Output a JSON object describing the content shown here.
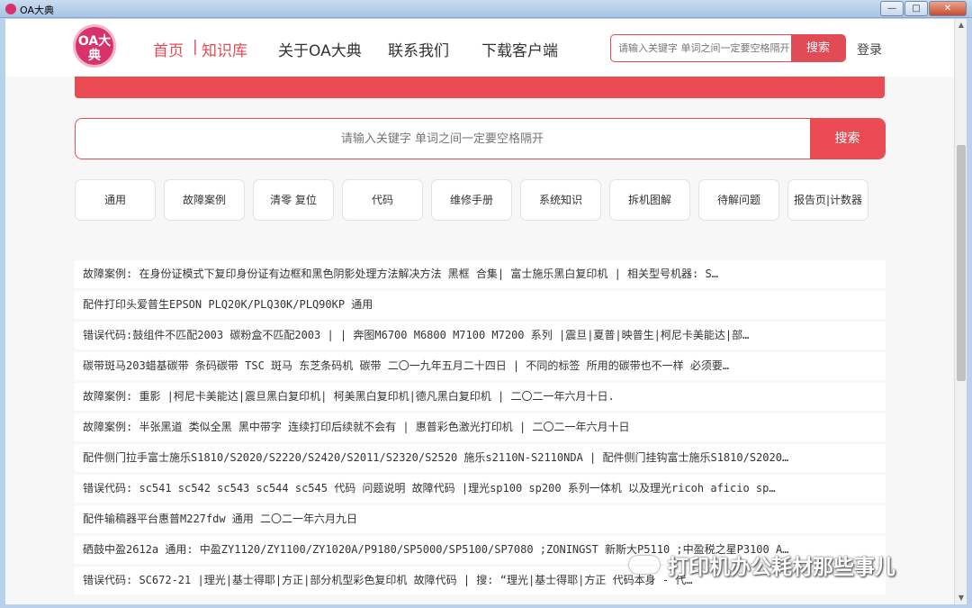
{
  "window": {
    "title": "OA大典",
    "minimize": "—",
    "maximize": "□",
    "close": "✕"
  },
  "nav": {
    "logo_text": "OA大典",
    "home": "首页",
    "sep": "|",
    "knowledge": "知识库",
    "about": "关于OA大典",
    "contact": "联系我们",
    "download": "下载客户端",
    "login": "登录"
  },
  "top_search": {
    "placeholder": "请输入关键字 单词之间一定要空格隔开",
    "button": "搜索"
  },
  "main_search": {
    "placeholder": "请输入关键字 单词之间一定要空格隔开",
    "button": "搜索"
  },
  "categories": [
    "通用",
    "故障案例",
    "清零 复位",
    "代码",
    "维修手册",
    "系统知识",
    "拆机图解",
    "待解问题",
    "报告页|计数器"
  ],
  "results": [
    "故障案例:  在身份证模式下复印身份证有边框和黑色阴影处理方法解决方法 黑框 合集| 富士施乐黑白复印机 | 相关型号机器: S…",
    "配件打印头爱普生EPSON PLQ20K/PLQ30K/PLQ90KP 通用",
    "错误代码:鼓组件不匹配2003 碳粉盒不匹配2003 | | 奔图M6700 M6800 M7100 M7200 系列 |震旦|夏普|映普生|柯尼卡美能达|部…",
    "碳带斑马203蜡基碳带 条码碳带 TSC 斑马 东芝条码机 碳带 二〇一九年五月二十四日 | 不同的标签 所用的碳带也不一样 必须要…",
    "故障案例:  重影 |柯尼卡美能达|震旦黑白复印机| 柯美黑白复印机|德凡黑白复印机 | 二〇二一年六月十日.",
    "故障案例:  半张黑道 类似全黑 黑中带字 连续打印后续就不会有 | 惠普彩色激光打印机 | 二〇二一年六月十日",
    "配件侧门拉手富士施乐S1810/S2020/S2220/S2420/S2011/S2320/S2520 施乐s2110N-S2110NDA | 配件侧门挂钩富士施乐S1810/S2020…",
    "错误代码:  sc541 sc542 sc543 sc544 sc545 代码 问题说明 故障代码 |理光sp100 sp200 系列一体机 以及理光ricoh aficio sp…",
    "配件输稿器平台惠普M227fdw 通用 二〇二一年六月九日",
    "硒鼓中盈2612a 通用: 中盈ZY1120/ZY1100/ZY1020A/P9180/SP5000/SP5100/SP7080 ;ZONINGST 新斯大P5110 ;中盈税之星P3100 A…",
    "错误代码:  SC672-21 |理光|基士得耶|方正|部分机型彩色复印机 故障代码 | 搜: “理光|基士得耶|方正 代码本身 - 代…"
  ],
  "watermark": "打印机办公耗材那些事儿"
}
